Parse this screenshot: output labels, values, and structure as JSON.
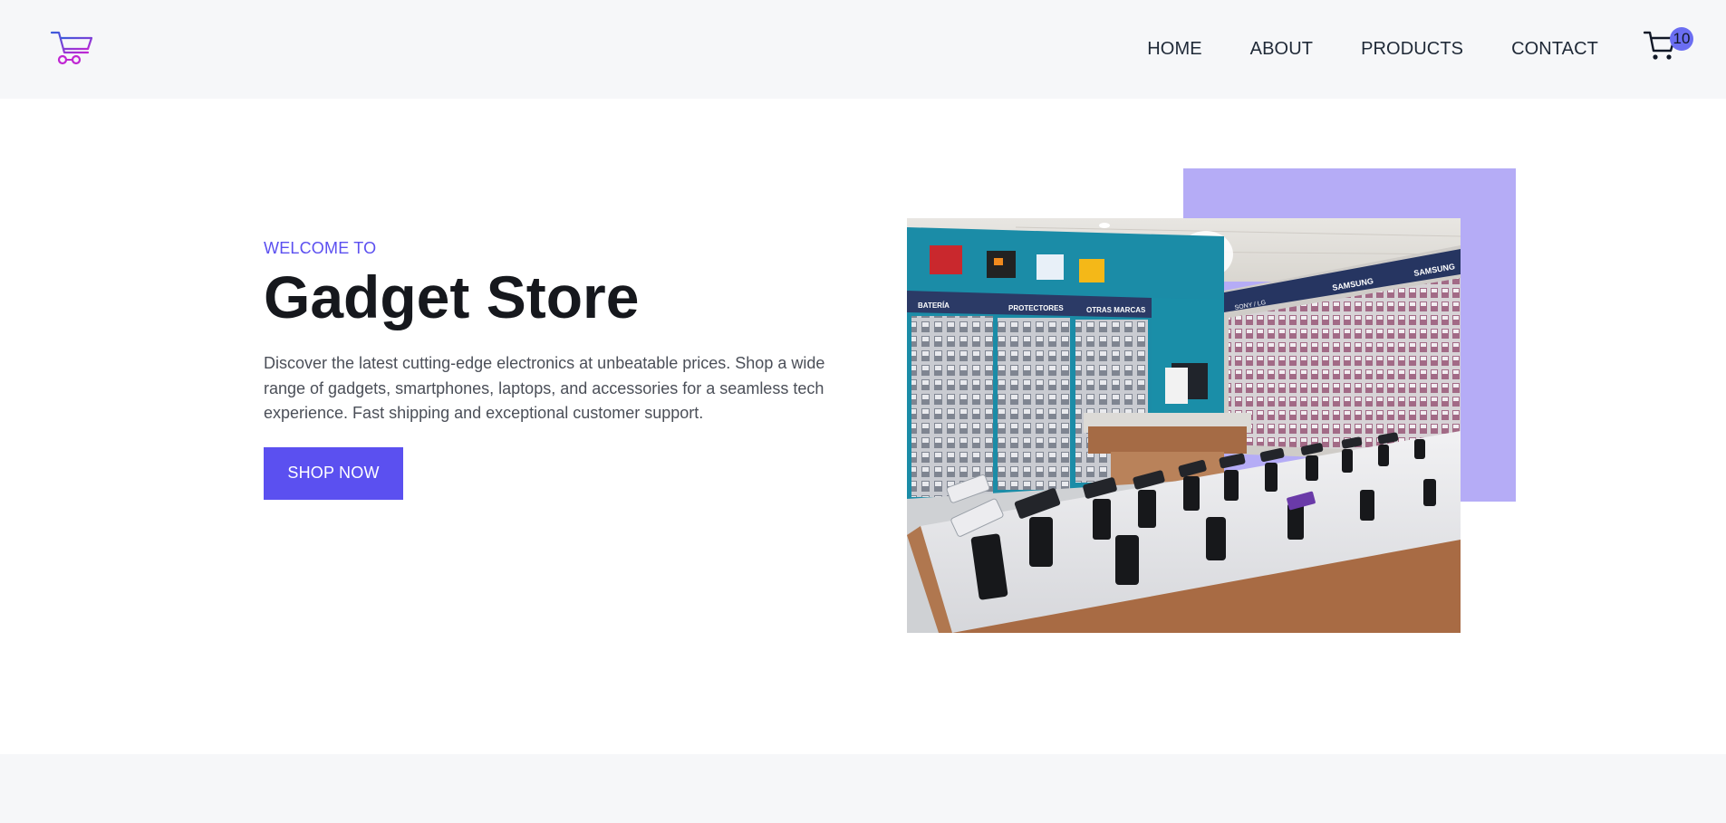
{
  "nav": {
    "items": [
      {
        "label": "HOME"
      },
      {
        "label": "ABOUT"
      },
      {
        "label": "PRODUCTS"
      },
      {
        "label": "CONTACT"
      }
    ]
  },
  "cart": {
    "count": "10",
    "icon": "cart-icon"
  },
  "logo": {
    "icon": "shopping-cart-logo-icon"
  },
  "hero": {
    "eyebrow": "WELCOME TO",
    "title": "Gadget Store",
    "description": "Discover the latest cutting-edge electronics at unbeatable prices. Shop a wide range of gadgets, smartphones, laptops, and accessories for a seamless tech experience. Fast shipping and exceptional customer support.",
    "cta_label": "SHOP NOW",
    "store_signs": [
      "BATERÍA",
      "PROTECTORES",
      "OTRAS MARCAS",
      "SONY / LG",
      "SAMSUNG",
      "SAMSUNG"
    ]
  },
  "colors": {
    "accent": "#5b50f0",
    "accent_light": "#b5acf6",
    "header_bg": "#f6f7f9",
    "badge": "#6b6ef2"
  }
}
